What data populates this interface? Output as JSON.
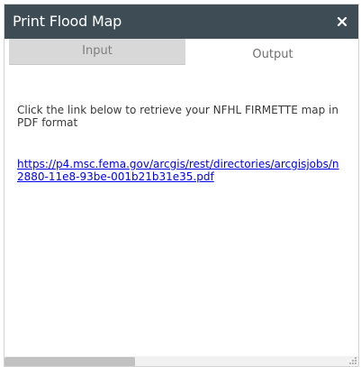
{
  "window": {
    "title": "Print Flood Map",
    "close_icon": "close-icon"
  },
  "tabs": [
    {
      "label": "Input",
      "active": false
    },
    {
      "label": "Output",
      "active": true
    }
  ],
  "output": {
    "message": "Click the link below to retrieve your NFHL FIRMETTE map in PDF format",
    "link_text": "https://p4.msc.fema.gov/arcgis/rest/directories/arcgisjobs/n\n2880-11e8-93be-001b21b31e35.pdf"
  },
  "colors": {
    "title_bar": "#3d4c55",
    "inactive_tab": "#d8d8d8",
    "link": "#0000ee"
  }
}
